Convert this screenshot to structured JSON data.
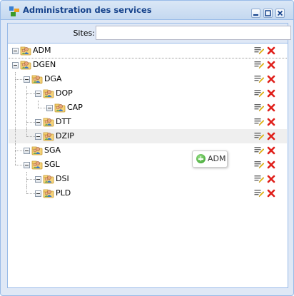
{
  "window": {
    "title": "Administration des services"
  },
  "form": {
    "sites_label": "Sites:",
    "sites_value": ""
  },
  "tree": [
    {
      "label": "ADM",
      "depth": 0,
      "selected": false
    },
    {
      "label": "DGEN",
      "depth": 0,
      "selected": false
    },
    {
      "label": "DGA",
      "depth": 1,
      "selected": false
    },
    {
      "label": "DOP",
      "depth": 2,
      "selected": false
    },
    {
      "label": "CAP",
      "depth": 3,
      "selected": false
    },
    {
      "label": "DTT",
      "depth": 2,
      "selected": false
    },
    {
      "label": "DZIP",
      "depth": 2,
      "selected": true
    },
    {
      "label": "SGA",
      "depth": 1,
      "selected": false
    },
    {
      "label": "SGL",
      "depth": 1,
      "selected": false
    },
    {
      "label": "DSI",
      "depth": 2,
      "selected": false
    },
    {
      "label": "PLD",
      "depth": 2,
      "selected": false
    }
  ],
  "drag_tooltip": {
    "label": "ADM"
  },
  "colors": {
    "title": "#15428b",
    "border": "#99bbe8",
    "delete": "#e0201b"
  }
}
